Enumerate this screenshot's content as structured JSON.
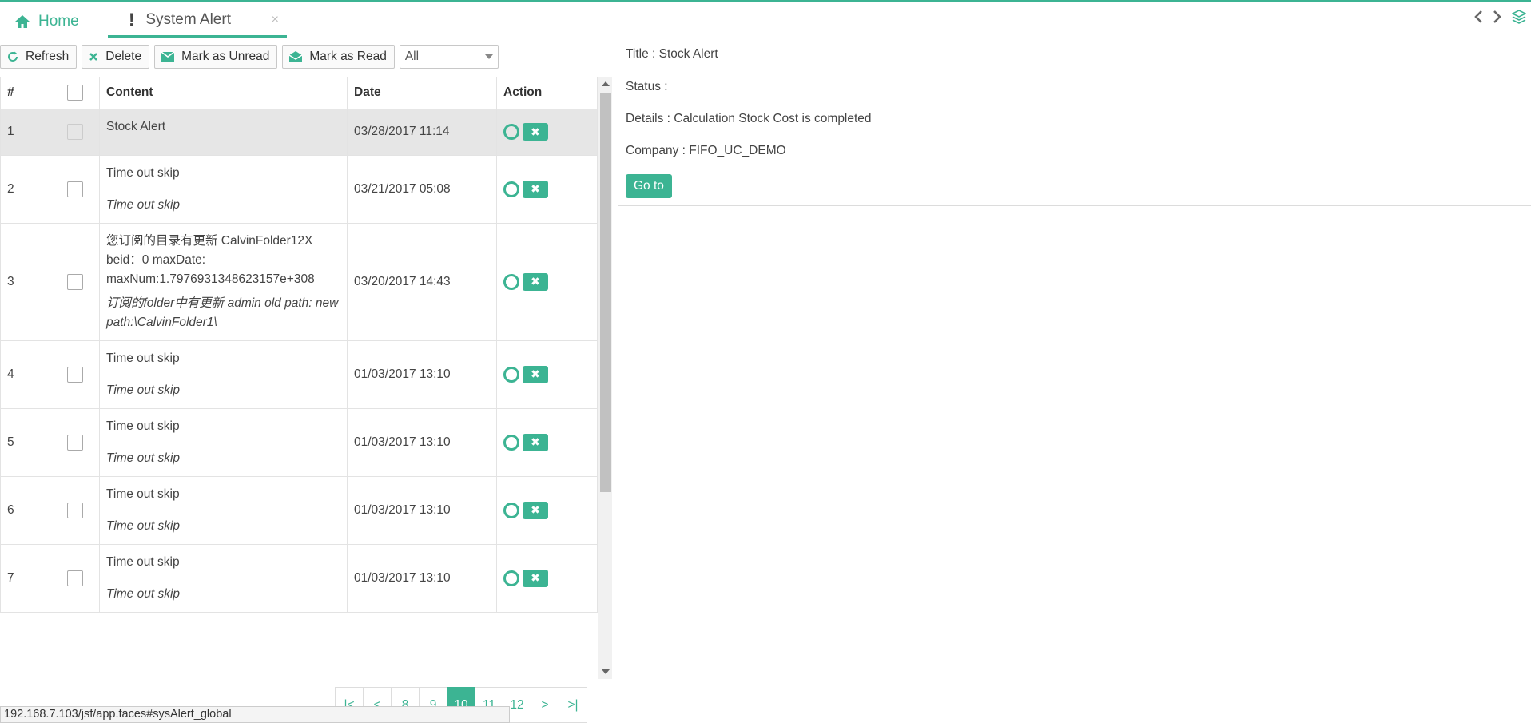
{
  "tabs": {
    "home_label": "Home",
    "alert_label": "System Alert",
    "close_glyph": "×"
  },
  "toolbar": {
    "refresh": "Refresh",
    "delete": "Delete",
    "mark_unread": "Mark as Unread",
    "mark_read": "Mark as Read",
    "filter_value": "All"
  },
  "table": {
    "headers": {
      "num": "#",
      "content": "Content",
      "date": "Date",
      "action": "Action"
    },
    "rows": [
      {
        "num": "1",
        "title": "Stock Alert",
        "detail": "",
        "date": "03/28/2017 11:14"
      },
      {
        "num": "2",
        "title": "Time out skip",
        "detail": "Time out skip",
        "date": "03/21/2017 05:08"
      },
      {
        "num": "3",
        "title": "您订阅的目录有更新 CalvinFolder12X beid：0 maxDate: maxNum:1.7976931348623157e+308",
        "detail": "订阅的folder中有更新 admin old path: new path:\\CalvinFolder1\\",
        "date": "03/20/2017 14:43"
      },
      {
        "num": "4",
        "title": "Time out skip",
        "detail": "Time out skip",
        "date": "01/03/2017 13:10"
      },
      {
        "num": "5",
        "title": "Time out skip",
        "detail": "Time out skip",
        "date": "01/03/2017 13:10"
      },
      {
        "num": "6",
        "title": "Time out skip",
        "detail": "Time out skip",
        "date": "01/03/2017 13:10"
      },
      {
        "num": "7",
        "title": "Time out skip",
        "detail": "Time out skip",
        "date": "01/03/2017 13:10"
      }
    ]
  },
  "pager": {
    "first": "|<",
    "prev": "<",
    "p8": "8",
    "p9": "9",
    "p10": "10",
    "p11": "11",
    "p12": "12",
    "next": ">",
    "last": ">|"
  },
  "status_url": "192.168.7.103/jsf/app.faces#sysAlert_global",
  "detail": {
    "title": "Title : Stock Alert",
    "status": "Status :",
    "details": "Details : Calculation Stock Cost is completed",
    "company": "Company : FIFO_UC_DEMO",
    "goto": "Go to"
  },
  "colors": {
    "accent": "#3cb493"
  }
}
